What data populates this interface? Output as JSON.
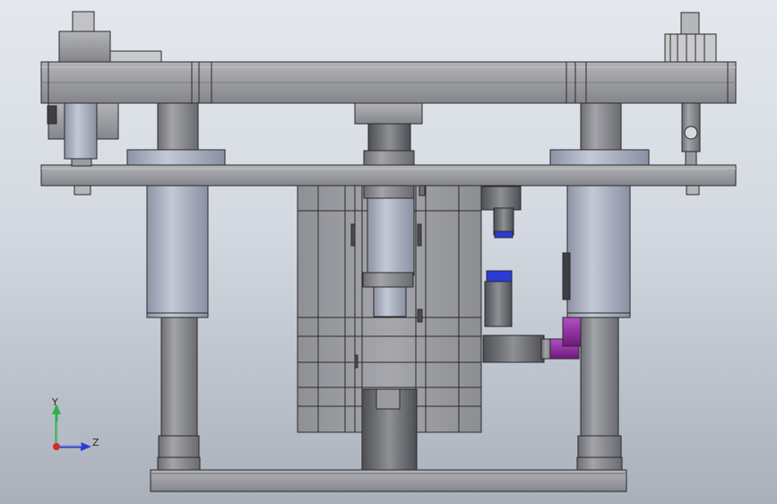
{
  "viewport": {
    "background_top": "#e4e8ee",
    "background_bottom": "#a9b0ba"
  },
  "colors": {
    "steel": "#9a9ca1",
    "steel_dark": "#6e7075",
    "cylinder": "#a9afbf",
    "fitting_purple": "#8a2a9b",
    "fitting_blue": "#2b3bd6",
    "outline": "#2a2a2a"
  },
  "triad": {
    "y_label": "Y",
    "z_label": "Z",
    "y_color": "#2fb24a",
    "z_color": "#2b3fd6",
    "origin_color": "#d42a2a"
  }
}
